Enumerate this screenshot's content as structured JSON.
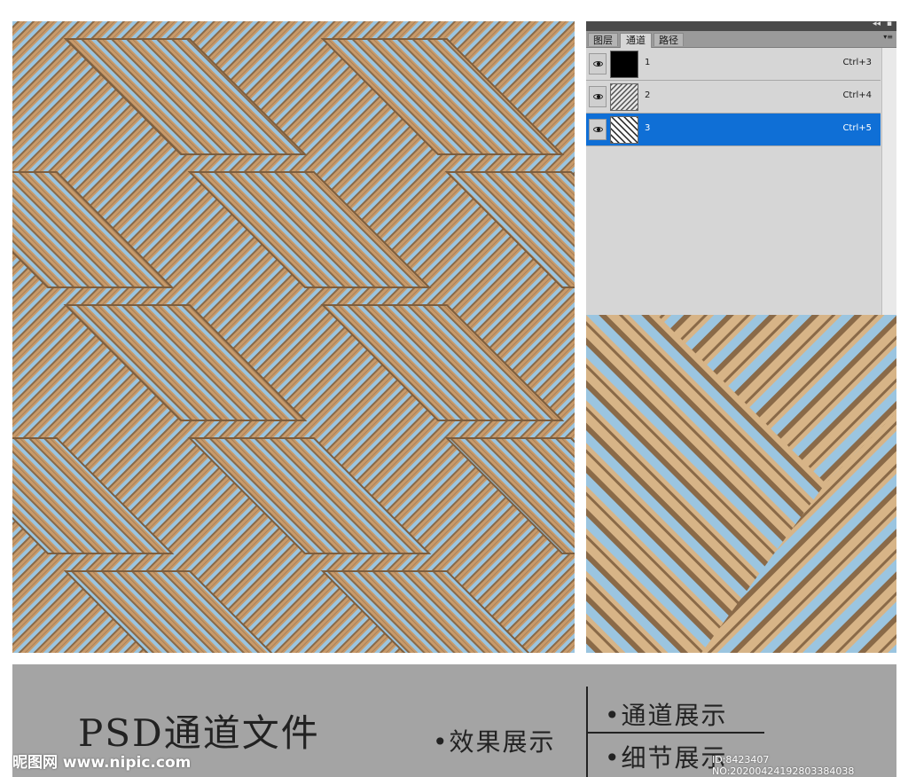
{
  "panel": {
    "tabs": [
      {
        "label": "图层"
      },
      {
        "label": "通道"
      },
      {
        "label": "路径"
      }
    ],
    "collapse_glyph": "◂◂",
    "close_glyph": "▪",
    "menu_glyph": "▾≡",
    "channels": [
      {
        "name": "1",
        "shortcut": "Ctrl+3",
        "thumb": "black",
        "selected": false
      },
      {
        "name": "2",
        "shortcut": "Ctrl+4",
        "thumb": "noise",
        "selected": false
      },
      {
        "name": "3",
        "shortcut": "Ctrl+5",
        "thumb": "noise",
        "selected": true
      }
    ]
  },
  "banner": {
    "title": "PSD通道文件",
    "items": [
      "•效果展示",
      "•通道展示",
      "•细节展示"
    ]
  },
  "watermark": {
    "left": "昵图网 www.nipic.com",
    "right": "ID:8423407 NO:20200424192803384038"
  },
  "colors": {
    "tan": "#d7b487",
    "brown": "#8a6a48",
    "sky": "#9bc5e0",
    "selected": "#0f6fd6",
    "banner": "#a4a4a4"
  }
}
